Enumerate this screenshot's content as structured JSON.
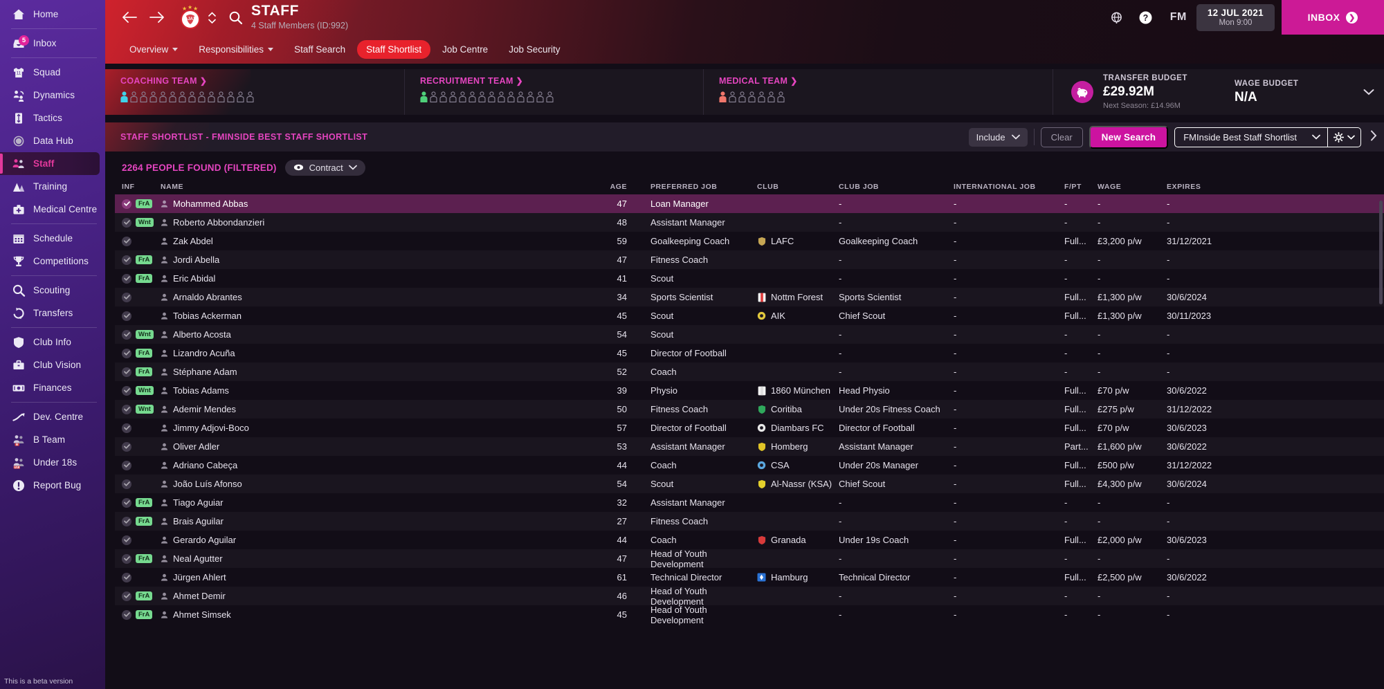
{
  "sidebar": {
    "items": [
      {
        "label": "Home",
        "icon": "home-icon",
        "active": false,
        "badge": null,
        "sep_after": true
      },
      {
        "label": "Inbox",
        "icon": "inbox-icon",
        "active": false,
        "badge": "5",
        "sep_after": true
      },
      {
        "label": "Squad",
        "icon": "shirt-icon",
        "active": false,
        "badge": null,
        "sep_after": false
      },
      {
        "label": "Dynamics",
        "icon": "dynamics-icon",
        "active": false,
        "badge": null,
        "sep_after": false
      },
      {
        "label": "Tactics",
        "icon": "tactics-icon",
        "active": false,
        "badge": null,
        "sep_after": false
      },
      {
        "label": "Data Hub",
        "icon": "data-hub-icon",
        "active": false,
        "badge": null,
        "sep_after": false
      },
      {
        "label": "Staff",
        "icon": "staff-icon",
        "active": true,
        "badge": null,
        "sep_after": false
      },
      {
        "label": "Training",
        "icon": "training-icon",
        "active": false,
        "badge": null,
        "sep_after": false
      },
      {
        "label": "Medical Centre",
        "icon": "medical-icon",
        "active": false,
        "badge": null,
        "sep_after": true
      },
      {
        "label": "Schedule",
        "icon": "calendar-icon",
        "active": false,
        "badge": null,
        "sep_after": false
      },
      {
        "label": "Competitions",
        "icon": "trophy-icon",
        "active": false,
        "badge": null,
        "sep_after": true
      },
      {
        "label": "Scouting",
        "icon": "search-icon",
        "active": false,
        "badge": null,
        "sep_after": false
      },
      {
        "label": "Transfers",
        "icon": "transfers-icon",
        "active": false,
        "badge": null,
        "sep_after": true
      },
      {
        "label": "Club Info",
        "icon": "shield-icon",
        "active": false,
        "badge": null,
        "sep_after": false
      },
      {
        "label": "Club Vision",
        "icon": "briefcase-icon",
        "active": false,
        "badge": null,
        "sep_after": false
      },
      {
        "label": "Finances",
        "icon": "banknote-icon",
        "active": false,
        "badge": null,
        "sep_after": true
      },
      {
        "label": "Dev. Centre",
        "icon": "trend-icon",
        "active": false,
        "badge": null,
        "sep_after": false
      },
      {
        "label": "B Team",
        "icon": "b-team-icon",
        "active": false,
        "badge": null,
        "sep_after": false
      },
      {
        "label": "Under 18s",
        "icon": "under18-icon",
        "active": false,
        "badge": null,
        "sep_after": false
      },
      {
        "label": "Report Bug",
        "icon": "report-bug-icon",
        "active": false,
        "badge": null,
        "sep_after": false
      }
    ],
    "beta_note": "This is a beta version"
  },
  "header": {
    "title": "STAFF",
    "subtitle": "4 Staff Members (ID:992)",
    "back_icon": "back-arrow-icon",
    "forward_icon": "forward-arrow-icon",
    "crest_icon": "ajax-crest-icon",
    "search_icon": "search-icon",
    "globe_icon": "globe-icon",
    "help_icon": "help-icon",
    "fm_logo": "FM",
    "date_main": "12 JUL 2021",
    "date_sub": "Mon 9:00",
    "inbox_label": "INBOX",
    "accent_red": "#e8222c",
    "accent_pink": "#cc1a96"
  },
  "tabs": [
    {
      "label": "Overview",
      "has_caret": true,
      "selected": false
    },
    {
      "label": "Responsibilities",
      "has_caret": true,
      "selected": false
    },
    {
      "label": "Staff Search",
      "has_caret": false,
      "selected": false
    },
    {
      "label": "Staff Shortlist",
      "has_caret": false,
      "selected": true
    },
    {
      "label": "Job Centre",
      "has_caret": false,
      "selected": false
    },
    {
      "label": "Job Security",
      "has_caret": false,
      "selected": false
    }
  ],
  "teams": [
    {
      "title": "COACHING TEAM",
      "filled": 1,
      "total": 14,
      "color": "#3fd2e8"
    },
    {
      "title": "RECRUITMENT TEAM",
      "filled": 1,
      "total": 14,
      "color": "#4fd07a"
    },
    {
      "title": "MEDICAL TEAM",
      "filled": 1,
      "total": 7,
      "color": "#f0766b"
    }
  ],
  "budgets": {
    "transfer_label": "TRANSFER BUDGET",
    "transfer_value": "£29.92M",
    "transfer_next": "Next Season: £14.96M",
    "wage_label": "WAGE BUDGET",
    "wage_value": "N/A",
    "piggy_icon": "piggy-bank-icon",
    "expand_icon": "chevron-down-icon"
  },
  "shortlist_bar": {
    "title": "STAFF SHORTLIST - FMINSIDE BEST STAFF SHORTLIST",
    "include_label": "Include",
    "clear_label": "Clear",
    "new_search_label": "New Search",
    "selected_shortlist": "FMInside Best Staff Shortlist",
    "gear_icon": "gear-icon",
    "more_icon": "chevron-right-icon"
  },
  "results": {
    "count_label": "2264 PEOPLE FOUND (FILTERED)",
    "view_label": "Contract",
    "view_icon": "eye-icon"
  },
  "table": {
    "columns": [
      "INF",
      "NAME",
      "AGE",
      "PREFERRED JOB",
      "CLUB",
      "CLUB JOB",
      "INTERNATIONAL JOB",
      "F/PT",
      "WAGE",
      "EXPIRES"
    ],
    "rows": [
      {
        "tag": "FrA",
        "name": "Mohammed Abbas",
        "age": "47",
        "pref": "Loan Manager",
        "club": "",
        "club_crest": "",
        "crest_color": "",
        "club_job": "-",
        "intl": "-",
        "fpt": "-",
        "wage": "-",
        "expires": "-",
        "selected": true
      },
      {
        "tag": "Wnt",
        "name": "Roberto Abbondanzieri",
        "age": "48",
        "pref": "Assistant Manager",
        "club": "",
        "club_crest": "",
        "crest_color": "",
        "club_job": "-",
        "intl": "-",
        "fpt": "-",
        "wage": "-",
        "expires": "-",
        "selected": false
      },
      {
        "tag": "",
        "name": "Zak Abdel",
        "age": "59",
        "pref": "Goalkeeping Coach",
        "club": "LAFC",
        "club_crest": "shield",
        "crest_color": "#c5a553",
        "club_job": "Goalkeeping Coach",
        "intl": "-",
        "fpt": "Full...",
        "wage": "£3,200 p/w",
        "expires": "31/12/2021",
        "selected": false
      },
      {
        "tag": "FrA",
        "name": "Jordi Abella",
        "age": "47",
        "pref": "Fitness Coach",
        "club": "",
        "club_crest": "",
        "crest_color": "",
        "club_job": "-",
        "intl": "-",
        "fpt": "-",
        "wage": "-",
        "expires": "-",
        "selected": false
      },
      {
        "tag": "FrA",
        "name": "Eric Abidal",
        "age": "41",
        "pref": "Scout",
        "club": "",
        "club_crest": "",
        "crest_color": "",
        "club_job": "-",
        "intl": "-",
        "fpt": "-",
        "wage": "-",
        "expires": "-",
        "selected": false
      },
      {
        "tag": "",
        "name": "Arnaldo Abrantes",
        "age": "34",
        "pref": "Sports Scientist",
        "club": "Nottm Forest",
        "club_crest": "stripe",
        "crest_color": "#e03b3b",
        "club_job": "Sports Scientist",
        "intl": "-",
        "fpt": "Full...",
        "wage": "£1,300 p/w",
        "expires": "30/6/2024",
        "selected": false
      },
      {
        "tag": "",
        "name": "Tobias Ackerman",
        "age": "45",
        "pref": "Scout",
        "club": "AIK",
        "club_crest": "circle",
        "crest_color": "#e2c93c",
        "club_job": "Chief Scout",
        "intl": "-",
        "fpt": "Full...",
        "wage": "£1,300 p/w",
        "expires": "30/11/2023",
        "selected": false
      },
      {
        "tag": "Wnt",
        "name": "Alberto Acosta",
        "age": "54",
        "pref": "Scout",
        "club": "",
        "club_crest": "",
        "crest_color": "",
        "club_job": "-",
        "intl": "-",
        "fpt": "-",
        "wage": "-",
        "expires": "-",
        "selected": false
      },
      {
        "tag": "FrA",
        "name": "Lizandro Acuña",
        "age": "45",
        "pref": "Director of Football",
        "club": "",
        "club_crest": "",
        "crest_color": "",
        "club_job": "-",
        "intl": "-",
        "fpt": "-",
        "wage": "-",
        "expires": "-",
        "selected": false
      },
      {
        "tag": "FrA",
        "name": "Stéphane Adam",
        "age": "52",
        "pref": "Coach",
        "club": "",
        "club_crest": "",
        "crest_color": "",
        "club_job": "-",
        "intl": "-",
        "fpt": "-",
        "wage": "-",
        "expires": "-",
        "selected": false
      },
      {
        "tag": "Wnt",
        "name": "Tobias Adams",
        "age": "39",
        "pref": "Physio",
        "club": "1860 München",
        "club_crest": "stripe",
        "crest_color": "#dcdcdc",
        "club_job": "Head Physio",
        "intl": "-",
        "fpt": "Full...",
        "wage": "£70 p/w",
        "expires": "30/6/2022",
        "selected": false
      },
      {
        "tag": "Wnt",
        "name": "Ademir Mendes",
        "age": "50",
        "pref": "Fitness Coach",
        "club": "Coritiba",
        "club_crest": "shield",
        "crest_color": "#2fa85b",
        "club_job": "Under 20s Fitness Coach",
        "intl": "-",
        "fpt": "Full...",
        "wage": "£275 p/w",
        "expires": "31/12/2022",
        "selected": false
      },
      {
        "tag": "",
        "name": "Jimmy Adjovi-Boco",
        "age": "57",
        "pref": "Director of Football",
        "club": "Diambars FC",
        "club_crest": "circle",
        "crest_color": "#e8e8e8",
        "club_job": "Director of Football",
        "intl": "-",
        "fpt": "Full...",
        "wage": "£70 p/w",
        "expires": "30/6/2023",
        "selected": false
      },
      {
        "tag": "",
        "name": "Oliver Adler",
        "age": "53",
        "pref": "Assistant Manager",
        "club": "Homberg",
        "club_crest": "shield",
        "crest_color": "#e0c427",
        "club_job": "Assistant Manager",
        "intl": "-",
        "fpt": "Part...",
        "wage": "£1,600 p/w",
        "expires": "30/6/2022",
        "selected": false
      },
      {
        "tag": "",
        "name": "Adriano Cabeça",
        "age": "44",
        "pref": "Coach",
        "club": "CSA",
        "club_crest": "circle",
        "crest_color": "#5aa8e0",
        "club_job": "Under 20s Manager",
        "intl": "-",
        "fpt": "Full...",
        "wage": "£500 p/w",
        "expires": "31/12/2022",
        "selected": false
      },
      {
        "tag": "",
        "name": "João Luís Afonso",
        "age": "54",
        "pref": "Scout",
        "club": "Al-Nassr (KSA)",
        "club_crest": "shield",
        "crest_color": "#e4d02c",
        "club_job": "Chief Scout",
        "intl": "-",
        "fpt": "Full...",
        "wage": "£4,300 p/w",
        "expires": "30/6/2024",
        "selected": false
      },
      {
        "tag": "FrA",
        "name": "Tiago Aguiar",
        "age": "32",
        "pref": "Assistant Manager",
        "club": "",
        "club_crest": "",
        "crest_color": "",
        "club_job": "-",
        "intl": "-",
        "fpt": "-",
        "wage": "-",
        "expires": "-",
        "selected": false
      },
      {
        "tag": "FrA",
        "name": "Brais Aguilar",
        "age": "27",
        "pref": "Fitness Coach",
        "club": "",
        "club_crest": "",
        "crest_color": "",
        "club_job": "-",
        "intl": "-",
        "fpt": "-",
        "wage": "-",
        "expires": "-",
        "selected": false
      },
      {
        "tag": "",
        "name": "Gerardo Aguilar",
        "age": "44",
        "pref": "Coach",
        "club": "Granada",
        "club_crest": "shield",
        "crest_color": "#d93a3a",
        "club_job": "Under 19s Coach",
        "intl": "-",
        "fpt": "Full...",
        "wage": "£2,000 p/w",
        "expires": "30/6/2023",
        "selected": false
      },
      {
        "tag": "FrA",
        "name": "Neal Agutter",
        "age": "47",
        "pref": "Head of Youth Development",
        "club": "",
        "club_crest": "",
        "crest_color": "",
        "club_job": "-",
        "intl": "-",
        "fpt": "-",
        "wage": "-",
        "expires": "-",
        "selected": false
      },
      {
        "tag": "",
        "name": "Jürgen Ahlert",
        "age": "61",
        "pref": "Technical Director",
        "club": "Hamburg",
        "club_crest": "square",
        "crest_color": "#2a72d4",
        "club_job": "Technical Director",
        "intl": "-",
        "fpt": "Full...",
        "wage": "£2,500 p/w",
        "expires": "30/6/2022",
        "selected": false
      },
      {
        "tag": "FrA",
        "name": "Ahmet Demir",
        "age": "46",
        "pref": "Head of Youth Development",
        "club": "",
        "club_crest": "",
        "crest_color": "",
        "club_job": "-",
        "intl": "-",
        "fpt": "-",
        "wage": "-",
        "expires": "-",
        "selected": false
      },
      {
        "tag": "FrA",
        "name": "Ahmet Simsek",
        "age": "45",
        "pref": "Head of Youth Development",
        "club": "",
        "club_crest": "",
        "crest_color": "",
        "club_job": "-",
        "intl": "-",
        "fpt": "-",
        "wage": "-",
        "expires": "-",
        "selected": false
      }
    ]
  }
}
